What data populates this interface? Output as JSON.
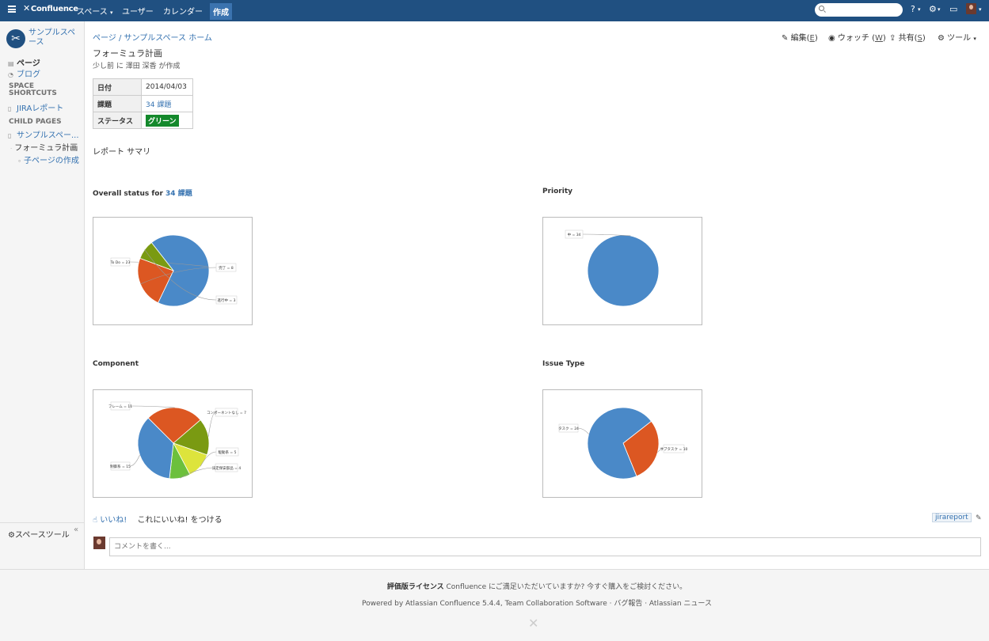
{
  "topnav": {
    "logo": "Confluence",
    "links": [
      "スペース",
      "ユーザー",
      "カレンダー"
    ],
    "create": "作成",
    "search_placeholder": ""
  },
  "sidebar": {
    "space_name": "サンプルスペース",
    "nav": [
      "ページ",
      "ブログ"
    ],
    "shortcuts_heading": "SPACE SHORTCUTS",
    "shortcuts": [
      "JIRAレポート"
    ],
    "child_heading": "CHILD PAGES",
    "parent_page": "サンプルスペー...",
    "current_page": "フォーミュラ計画",
    "create_child": "子ページの作成",
    "space_tools": "スペースツール"
  },
  "page": {
    "breadcrumb": "ページ / サンプルスペース ホーム",
    "actions": {
      "edit": "編集(",
      "edit_key": "E",
      "watch": "ウォッチ (",
      "watch_key": "W",
      "share": "共有(",
      "share_key": "S",
      "tools": "ツール"
    },
    "title": "フォーミュラ計画",
    "byline": "少し前 に 澤田 深香 が作成",
    "properties": [
      {
        "key": "日付",
        "value": "2014/04/03"
      },
      {
        "key": "課題",
        "value": "34 課題"
      },
      {
        "key": "ステータス",
        "value": "グリーン"
      }
    ],
    "report_summary": "レポート サマリ",
    "like": "いいね!",
    "like_prompt": "これにいいね! をつける",
    "label": "jirareport",
    "comment_placeholder": "コメントを書く..."
  },
  "charts": {
    "overall": {
      "title": "Overall status for",
      "link": "34 課題"
    },
    "priority": {
      "title": "Priority"
    },
    "component": {
      "title": "Component"
    },
    "issue_type": {
      "title": "Issue Type"
    }
  },
  "chart_data": [
    {
      "type": "pie",
      "title": "Overall status for 34 課題",
      "categories": [
        "To Do",
        "完了",
        "進行中"
      ],
      "values": [
        23,
        8,
        3
      ],
      "labels": [
        "To Do = 23",
        "完了 = 8",
        "進行中 = 3"
      ],
      "colors": [
        "#4a89c8",
        "#dc5722",
        "#7a9a12"
      ]
    },
    {
      "type": "pie",
      "title": "Priority",
      "categories": [
        "中"
      ],
      "values": [
        34
      ],
      "labels": [
        "中 = 34"
      ],
      "colors": [
        "#4a89c8"
      ]
    },
    {
      "type": "pie",
      "title": "Component",
      "categories": [
        "フレーム",
        "コンポーネントなし",
        "駆動系",
        "法定保安部品",
        "制御系"
      ],
      "values": [
        11,
        7,
        5,
        4,
        15
      ],
      "labels": [
        "フレーム = 11",
        "コンポーネントなし = 7",
        "駆動系 = 5",
        "法定保安部品 = 4",
        "制御系 = 15"
      ],
      "colors": [
        "#dc5722",
        "#7a9a12",
        "#dde43c",
        "#6cc03c",
        "#4a89c8"
      ]
    },
    {
      "type": "pie",
      "title": "Issue Type",
      "categories": [
        "サブタスク",
        "タスク"
      ],
      "values": [
        10,
        24
      ],
      "labels": [
        "サブタスク = 10",
        "タスク = 24"
      ],
      "colors": [
        "#dc5722",
        "#4a89c8"
      ]
    }
  ],
  "footer": {
    "license_bold": "評価版ライセンス",
    "license_text": " Confluence にご満足いただいていますか? 今すぐ購入をご検討ください。",
    "powered": "Powered by Atlassian Confluence 5.4.4, Team Collaboration Software · バグ報告 · Atlassian ニュース"
  }
}
